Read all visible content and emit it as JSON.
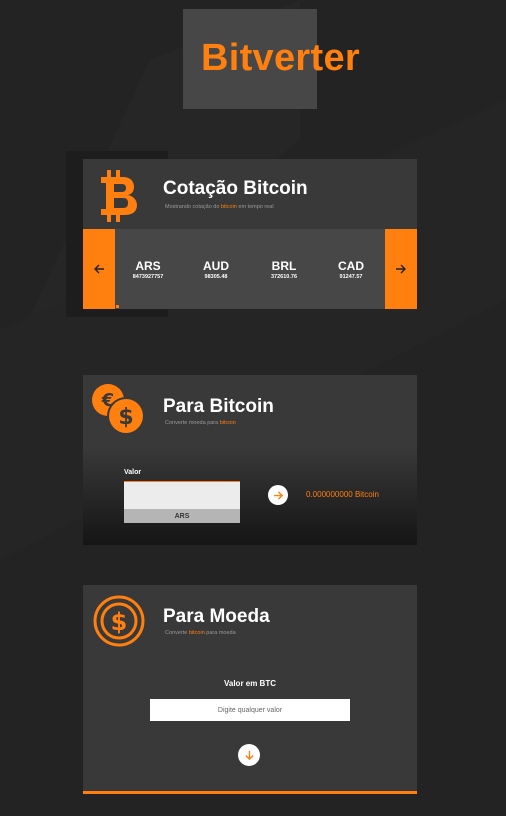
{
  "app": {
    "title": "Bitverter"
  },
  "colors": {
    "accent": "#ff7f0f",
    "background": "#232323",
    "card": "#393939"
  },
  "rates": {
    "title": "Cotação Bitcoin",
    "subtitle_pre": "Mostrando cotação do ",
    "subtitle_hl": "bitcoin",
    "subtitle_post": " em tempo real",
    "icon": "bitcoin-icon",
    "currencies": [
      {
        "code": "ARS",
        "value": "8473927757"
      },
      {
        "code": "AUD",
        "value": "98305.48"
      },
      {
        "code": "BRL",
        "value": "372610.76"
      },
      {
        "code": "CAD",
        "value": "91247.57"
      }
    ],
    "prev_icon": "arrow-left-icon",
    "next_icon": "arrow-right-icon"
  },
  "to_bitcoin": {
    "title": "Para Bitcoin",
    "subtitle_pre": "Converte moeda para ",
    "subtitle_hl": "bitcoin",
    "icon": "currency-coins-icon",
    "value_label": "Valor",
    "input_value": "",
    "selected_currency": "ARS",
    "result": "0.000000000 Bitcoin",
    "convert_icon": "arrow-right-icon"
  },
  "to_currency": {
    "title": "Para Moeda",
    "subtitle_pre": "Converte ",
    "subtitle_hl": "bitcoin",
    "subtitle_post": " para moeda",
    "icon": "dollar-coin-icon",
    "btc_label": "Valor em BTC",
    "btc_placeholder": "Digite qualquer valor",
    "convert_icon": "arrow-down-icon"
  }
}
